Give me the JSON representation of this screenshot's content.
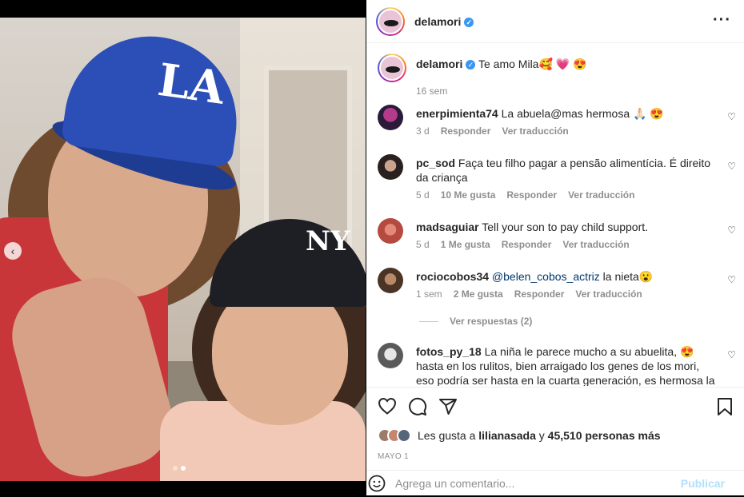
{
  "post": {
    "username": "delamori",
    "verified": true
  },
  "caption": {
    "username": "delamori",
    "text": "Te amo Mila🥰 💗 😍",
    "time": "16 sem"
  },
  "comments": [
    {
      "username": "enerpimienta74",
      "text": "La abuela@mas hermosa 🙏🏻 😍",
      "time": "3 d",
      "likes": "",
      "reply": "Responder",
      "translate": "Ver traducción"
    },
    {
      "username": "pc_sod",
      "text": "Faça teu filho pagar a pensão alimentícia. É direito da criança",
      "time": "5 d",
      "likes": "10 Me gusta",
      "reply": "Responder",
      "translate": "Ver traducción"
    },
    {
      "username": "madsaguiar",
      "text": "Tell your son to pay child support.",
      "time": "5 d",
      "likes": "1 Me gusta",
      "reply": "Responder",
      "translate": "Ver traducción"
    },
    {
      "username": "rociocobos34",
      "mention": "@belen_cobos_actriz",
      "text": " la nieta😮",
      "time": "1 sem",
      "likes": "2 Me gusta",
      "reply": "Responder",
      "translate": "Ver traducción"
    },
    {
      "username": "fotos_py_18",
      "text": "La niña le parece mucho a su abuelita, 😍 hasta en los rulitos, bien arraigado los genes de los mori, eso podría ser hasta en la cuarta generación, es hermosa la niña 😍 😍 😍 🙌"
    }
  ],
  "view_replies": "Ver respuestas (2)",
  "likes_line": {
    "prefix": "Les gusta a",
    "user": "lilianasada",
    "middle": "y",
    "count": "45,510 personas más"
  },
  "date": "MAYO 1",
  "add_comment": {
    "placeholder": "Agrega un comentario...",
    "publish": "Publicar"
  },
  "photo": {
    "cap1_logo": "LA",
    "cap2_logo": "NY"
  },
  "colors": {
    "verified": "#3897f0",
    "publish_disabled": "#b2dffc",
    "mention": "#00376b"
  }
}
